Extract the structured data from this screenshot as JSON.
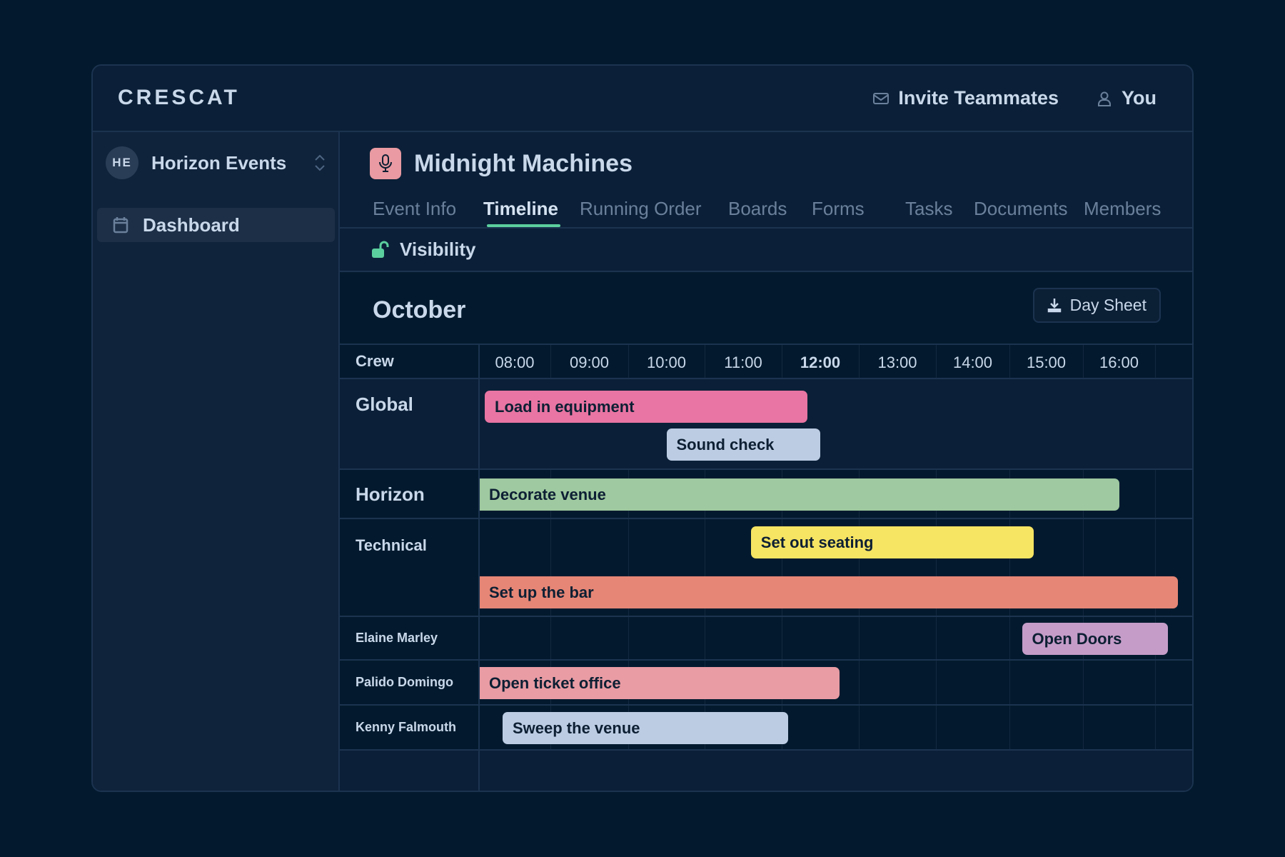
{
  "app": {
    "brand": "CRESCAT",
    "invite_label": "Invite Teammates",
    "user_label": "You"
  },
  "sidebar": {
    "workspace": {
      "initials": "HE",
      "name": "Horizon Events"
    },
    "items": [
      {
        "label": "Dashboard",
        "icon": "calendar-icon",
        "active": true
      }
    ]
  },
  "event": {
    "title": "Midnight Machines",
    "icon": "microphone-icon",
    "icon_color": "#e99aa2"
  },
  "tabs": [
    {
      "label": "Event Info",
      "active": false
    },
    {
      "label": "Timeline",
      "active": true
    },
    {
      "label": "Running Order",
      "active": false
    },
    {
      "label": "Boards",
      "active": false
    },
    {
      "label": "Forms",
      "active": false
    },
    {
      "label": "Tasks",
      "active": false
    },
    {
      "label": "Documents",
      "active": false
    },
    {
      "label": "Members",
      "active": false
    }
  ],
  "accent_color": "#5ccf9e",
  "visibility": {
    "label": "Visibility",
    "icon": "unlock-icon"
  },
  "timeline": {
    "month": "October",
    "day_sheet_label": "Day Sheet",
    "crew_header": "Crew",
    "hours": [
      "08:00",
      "09:00",
      "10:00",
      "11:00",
      "12:00",
      "13:00",
      "14:00",
      "15:00",
      "16:00"
    ],
    "current_hour": "12:00",
    "rows": [
      {
        "label": "Global",
        "style": "group",
        "tasks": [
          {
            "name": "Load in equipment",
            "start": 8.08,
            "end": 12.33,
            "lane": 0,
            "color": "#e875a3"
          },
          {
            "name": "Sound check",
            "start": 10.5,
            "end": 12.5,
            "lane": 1,
            "color": "#bccde3"
          }
        ]
      },
      {
        "label": "Horizon",
        "style": "group",
        "tasks": [
          {
            "name": "Decorate venue",
            "start": 8.0,
            "end": 16.5,
            "lane": 0,
            "color": "#9fc9a0"
          }
        ]
      },
      {
        "label": "Technical",
        "style": "subgroup",
        "tasks": [
          {
            "name": "Set out seating",
            "start": 11.6,
            "end": 15.33,
            "lane": 0,
            "color": "#f6e463"
          },
          {
            "name": "Set up the bar",
            "start": 8.0,
            "end": 17.6,
            "lane": 1,
            "color": "#e68676"
          }
        ]
      },
      {
        "label": "Elaine Marley",
        "style": "person",
        "tasks": [
          {
            "name": "Open Doors",
            "start": 15.17,
            "end": 17.33,
            "lane": 0,
            "color": "#c59cc8"
          }
        ]
      },
      {
        "label": "Palido Domingo",
        "style": "person",
        "tasks": [
          {
            "name": "Open ticket office",
            "start": 8.0,
            "end": 12.75,
            "lane": 0,
            "color": "#e99ca4"
          }
        ]
      },
      {
        "label": "Kenny Falmouth",
        "style": "person",
        "tasks": [
          {
            "name": "Sweep the venue",
            "start": 8.33,
            "end": 12.08,
            "lane": 0,
            "color": "#bccde3"
          }
        ]
      }
    ]
  }
}
